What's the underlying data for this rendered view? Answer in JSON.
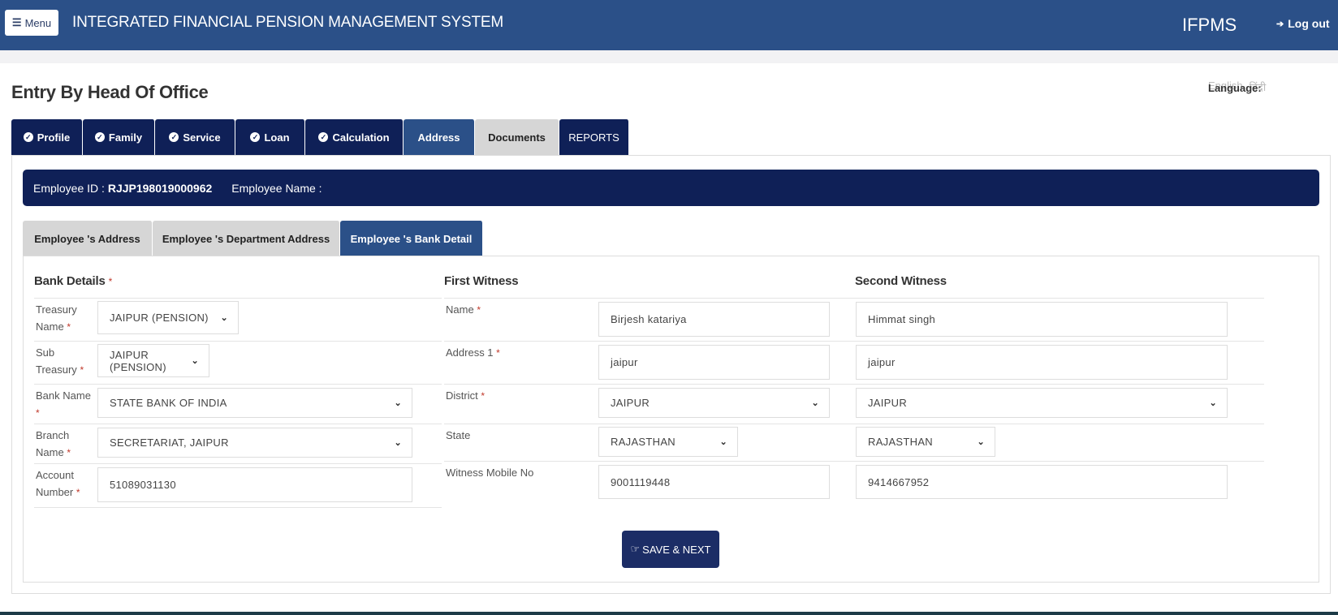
{
  "header": {
    "menu_label": "Menu",
    "menu_icon": "hamburger-icon",
    "app_title": "INTEGRATED FINANCIAL PENSION MANAGEMENT SYSTEM",
    "brand": "IFPMS",
    "logout_label": "Log out",
    "logout_icon": "sign-out-icon"
  },
  "page": {
    "title": "Entry By Head Of Office",
    "language_label": "Language:",
    "language_options": [
      "English",
      "हिंदी"
    ]
  },
  "main_tabs": [
    {
      "label": "Profile",
      "checked": true
    },
    {
      "label": "Family",
      "checked": true
    },
    {
      "label": "Service",
      "checked": true
    },
    {
      "label": "Loan",
      "checked": true
    },
    {
      "label": "Calculation",
      "checked": true
    },
    {
      "label": "Address",
      "checked": false,
      "active": true
    },
    {
      "label": "Documents",
      "checked": false
    },
    {
      "label": "REPORTS",
      "checked": false
    }
  ],
  "employee": {
    "id_label": "Employee ID :",
    "id_value": "RJJP198019000962",
    "name_label": "Employee Name :",
    "name_value": ""
  },
  "sub_tabs": [
    {
      "label": "Employee 's Address"
    },
    {
      "label": "Employee 's Department Address"
    },
    {
      "label": "Employee 's Bank Detail",
      "active": true
    }
  ],
  "bank_details": {
    "title": "Bank Details",
    "required_mark": "*",
    "fields": [
      {
        "label_line1": "Treasury",
        "label_line2": "Name",
        "required": "*",
        "value": "JAIPUR (PENSION)",
        "type": "select"
      },
      {
        "label_line1": "Sub",
        "label_line2": "Treasury",
        "required": "*",
        "value": "JAIPUR (PENSION)",
        "type": "select"
      },
      {
        "label_line1": "Bank Name",
        "label_line2": "",
        "required": "*",
        "value": "STATE BANK OF INDIA",
        "type": "select"
      },
      {
        "label_line1": "Branch",
        "label_line2": "Name",
        "required": "*",
        "value": "SECRETARIAT, JAIPUR",
        "type": "select"
      },
      {
        "label_line1": "Account",
        "label_line2": "Number",
        "required": "*",
        "value": "51089031130",
        "type": "input"
      }
    ]
  },
  "first_witness": {
    "title": "First Witness",
    "labels": {
      "name": "Name",
      "address": "Address 1",
      "district": "District",
      "state": "State",
      "mobile": "Witness Mobile No"
    },
    "required_mark": "*",
    "name": "Birjesh katariya",
    "address": "jaipur",
    "district": "JAIPUR",
    "state": "RAJASTHAN",
    "mobile": "9001119448"
  },
  "second_witness": {
    "title": "Second Witness",
    "name": "Himmat singh",
    "address": "jaipur",
    "district": "JAIPUR",
    "state": "RAJASTHAN",
    "mobile": "9414667952"
  },
  "actions": {
    "save_next_label": "SAVE & NEXT",
    "save_next_icon": "thumbs-up-icon"
  },
  "colors": {
    "header_bg": "#2b5088",
    "tab_dark": "#0f2057",
    "tab_active": "#2b5088",
    "tab_inactive": "#d6d6d6",
    "required": "#c0392b"
  }
}
